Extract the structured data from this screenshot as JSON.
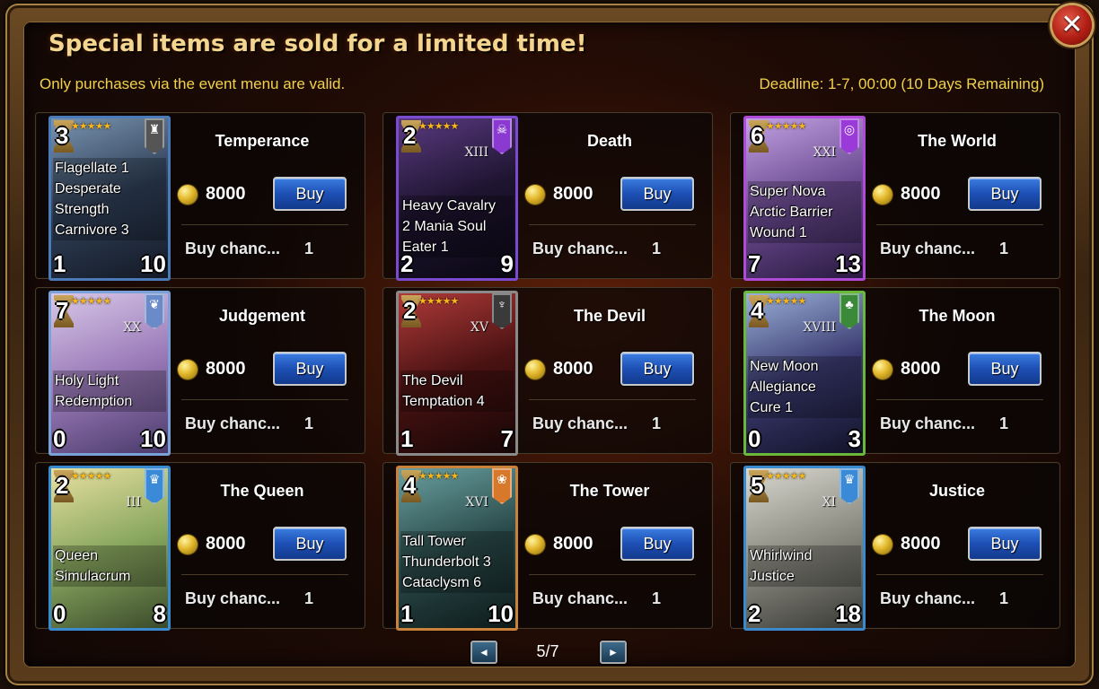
{
  "dialog": {
    "title": "Special items are sold for a limited time!",
    "subtitle": "Only purchases via the event menu are valid.",
    "deadline": "Deadline: 1-7, 00:00 (10 Days Remaining)",
    "close_symbol": "✕"
  },
  "items": [
    {
      "name": "Temperance",
      "level": "3",
      "stars": "★★★★★",
      "atk": "1",
      "hp": "10",
      "skills": "Flagellate 1\nDesperate\nStrength\nCarnivore 3",
      "numeral": "",
      "emblem_icon": "demon-crest-icon",
      "emblem_glyph": "♜",
      "border_color": "#4b7ab8",
      "art": [
        "#7a94b0",
        "#2e3e56",
        "#141a26"
      ],
      "emblem_color": "#555",
      "price": "8000",
      "buy_label": "Buy",
      "chance_label": "Buy chanc...",
      "chance_value": "1"
    },
    {
      "name": "Death",
      "level": "2",
      "stars": "★★★★★",
      "atk": "2",
      "hp": "9",
      "skills": "Heavy Cavalry\n2 Mania Soul\nEater 1",
      "numeral": "XIII",
      "emblem_icon": "skull-crest-icon",
      "emblem_glyph": "☠",
      "border_color": "#7a4bd0",
      "art": [
        "#5a3a80",
        "#1e1430",
        "#0b0814"
      ],
      "emblem_color": "#8a3ad0",
      "price": "8000",
      "buy_label": "Buy",
      "chance_label": "Buy chanc...",
      "chance_value": "1"
    },
    {
      "name": "The World",
      "level": "6",
      "stars": "★★★★★",
      "atk": "7",
      "hp": "13",
      "skills": "Super Nova\nArctic Barrier\nWound 1",
      "numeral": "XXI",
      "emblem_icon": "swirl-crest-icon",
      "emblem_glyph": "◎",
      "border_color": "#b04bd8",
      "art": [
        "#c2a2e2",
        "#6a4a90",
        "#2a1a40"
      ],
      "emblem_color": "#9a3ad8",
      "price": "8000",
      "buy_label": "Buy",
      "chance_label": "Buy chanc...",
      "chance_value": "1"
    },
    {
      "name": "Judgement",
      "level": "7",
      "stars": "★★★★★",
      "atk": "0",
      "hp": "10",
      "skills": "Holy Light\nRedemption",
      "numeral": "XX",
      "emblem_icon": "wing-crest-icon",
      "emblem_glyph": "❦",
      "border_color": "#7aa0d8",
      "art": [
        "#d8c8e8",
        "#9a7ab8",
        "#4a3a6a"
      ],
      "emblem_color": "#6a8ac8",
      "price": "8000",
      "buy_label": "Buy",
      "chance_label": "Buy chanc...",
      "chance_value": "1"
    },
    {
      "name": "The Devil",
      "level": "2",
      "stars": "★★★★★",
      "atk": "1",
      "hp": "7",
      "skills": "The Devil\nTemptation 4",
      "numeral": "XV",
      "emblem_icon": "horn-crest-icon",
      "emblem_glyph": "♆",
      "border_color": "#8a8a8a",
      "art": [
        "#b03a3a",
        "#4a1212",
        "#160606"
      ],
      "emblem_color": "#3a3a3a",
      "price": "8000",
      "buy_label": "Buy",
      "chance_label": "Buy chanc...",
      "chance_value": "1"
    },
    {
      "name": "The Moon",
      "level": "4",
      "stars": "★★★★★",
      "atk": "0",
      "hp": "3",
      "skills": "New Moon\nAllegiance\nCure 1",
      "numeral": "XVIII",
      "emblem_icon": "leaf-crest-icon",
      "emblem_glyph": "♣",
      "border_color": "#6ab83a",
      "art": [
        "#9ab0d8",
        "#3a3a70",
        "#121228"
      ],
      "emblem_color": "#3a8a3a",
      "price": "8000",
      "buy_label": "Buy",
      "chance_label": "Buy chanc...",
      "chance_value": "1"
    },
    {
      "name": "The Queen",
      "level": "2",
      "stars": "★★★★★",
      "atk": "0",
      "hp": "8",
      "skills": "Queen\nSimulacrum",
      "numeral": "III",
      "emblem_icon": "crown-crest-icon",
      "emblem_glyph": "♛",
      "border_color": "#3a8ad0",
      "art": [
        "#e8e0a0",
        "#8aa860",
        "#3a4a2a"
      ],
      "emblem_color": "#3a8ad8",
      "price": "8000",
      "buy_label": "Buy",
      "chance_label": "Buy chanc...",
      "chance_value": "1"
    },
    {
      "name": "The Tower",
      "level": "4",
      "stars": "★★★★★",
      "atk": "1",
      "hp": "10",
      "skills": "Tall Tower\nThunderbolt 3\nCataclysm 6",
      "numeral": "XVI",
      "emblem_icon": "paw-crest-icon",
      "emblem_glyph": "❀",
      "border_color": "#c8823a",
      "art": [
        "#6aa0a0",
        "#2a4a4a",
        "#0e1a1a"
      ],
      "emblem_color": "#d8782a",
      "price": "8000",
      "buy_label": "Buy",
      "chance_label": "Buy chanc...",
      "chance_value": "1"
    },
    {
      "name": "Justice",
      "level": "5",
      "stars": "★★★★★",
      "atk": "2",
      "hp": "18",
      "skills": "Whirlwind\nJustice",
      "numeral": "XI",
      "emblem_icon": "crown-crest-icon",
      "emblem_glyph": "♛",
      "border_color": "#3a8ad0",
      "art": [
        "#d8d8d0",
        "#8a8a80",
        "#3a3a36"
      ],
      "emblem_color": "#3a8ad8",
      "price": "8000",
      "buy_label": "Buy",
      "chance_label": "Buy chanc...",
      "chance_value": "1"
    }
  ],
  "pager": {
    "text": "5/7",
    "prev_symbol": "◄",
    "next_symbol": "►"
  }
}
